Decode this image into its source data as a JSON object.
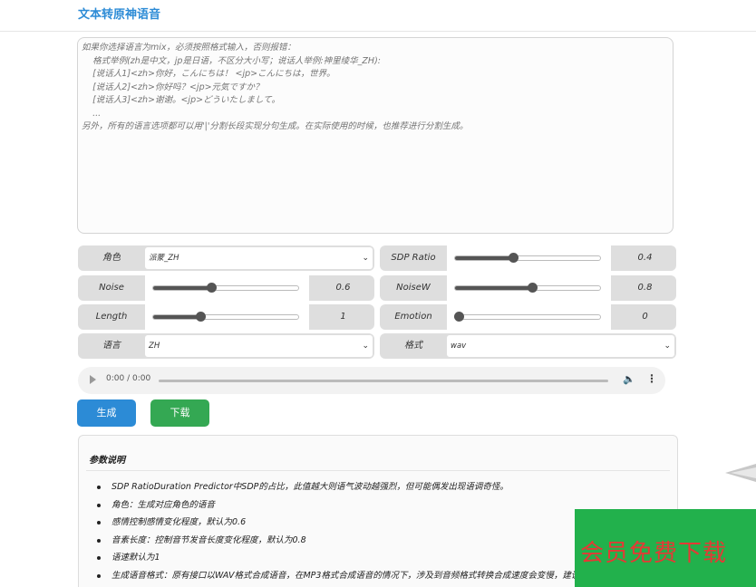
{
  "header": {
    "title": "文本转原神语音"
  },
  "textarea": {
    "placeholder": "如果你选择语言为mix，必须按照格式输入，否则报错：\n    格式举例(zh是中文，jp是日语，不区分大小写；说话人举例:神里绫华_ZH):\n    [说话人1]<zh>你好，こんにちは！ <jp>こんにちは，世界。\n    [说话人2]<zh>你好吗？<jp>元気ですか？\n    [说话人3]<zh>谢谢。<jp>どういたしまして。\n    ...\n另外，所有的语言选项都可以用'|'分割长段实现分句生成。在实际使用的时候，也推荐进行分割生成。"
  },
  "controls": {
    "role": {
      "label": "角色",
      "value": "派蒙_ZH"
    },
    "sdp_ratio": {
      "label": "SDP Ratio",
      "value": "0.4",
      "fraction": 0.4
    },
    "noise": {
      "label": "Noise",
      "value": "0.6",
      "fraction": 0.4
    },
    "noisew": {
      "label": "NoiseW",
      "value": "0.8",
      "fraction": 0.53
    },
    "length": {
      "label": "Length",
      "value": "1",
      "fraction": 0.33
    },
    "emotion": {
      "label": "Emotion",
      "value": "0",
      "fraction": 0.0
    },
    "language": {
      "label": "语言",
      "value": "ZH"
    },
    "format": {
      "label": "格式",
      "value": "wav"
    }
  },
  "audio": {
    "time": "0:00 / 0:00"
  },
  "buttons": {
    "generate": "生成",
    "download": "下载"
  },
  "params": {
    "title": "参数说明",
    "items": [
      "SDP RatioDuration Predictor中SDP的占比，此值越大则语气波动越强烈，但可能偶发出现语调奇怪。",
      "角色：生成对应角色的语音",
      "感情控制感情变化程度，默认为0.6",
      "音素长度：控制音节发音长度变化程度，默认为0.8",
      "语速默认为1",
      "生成语音格式：原有接口以WAV格式合成语音，在MP3格式合成语音的情况下，涉及到音频格式转换合成速度会变慢，建议选择WAV格式"
    ]
  },
  "promo": {
    "text": "会员免费下载"
  }
}
